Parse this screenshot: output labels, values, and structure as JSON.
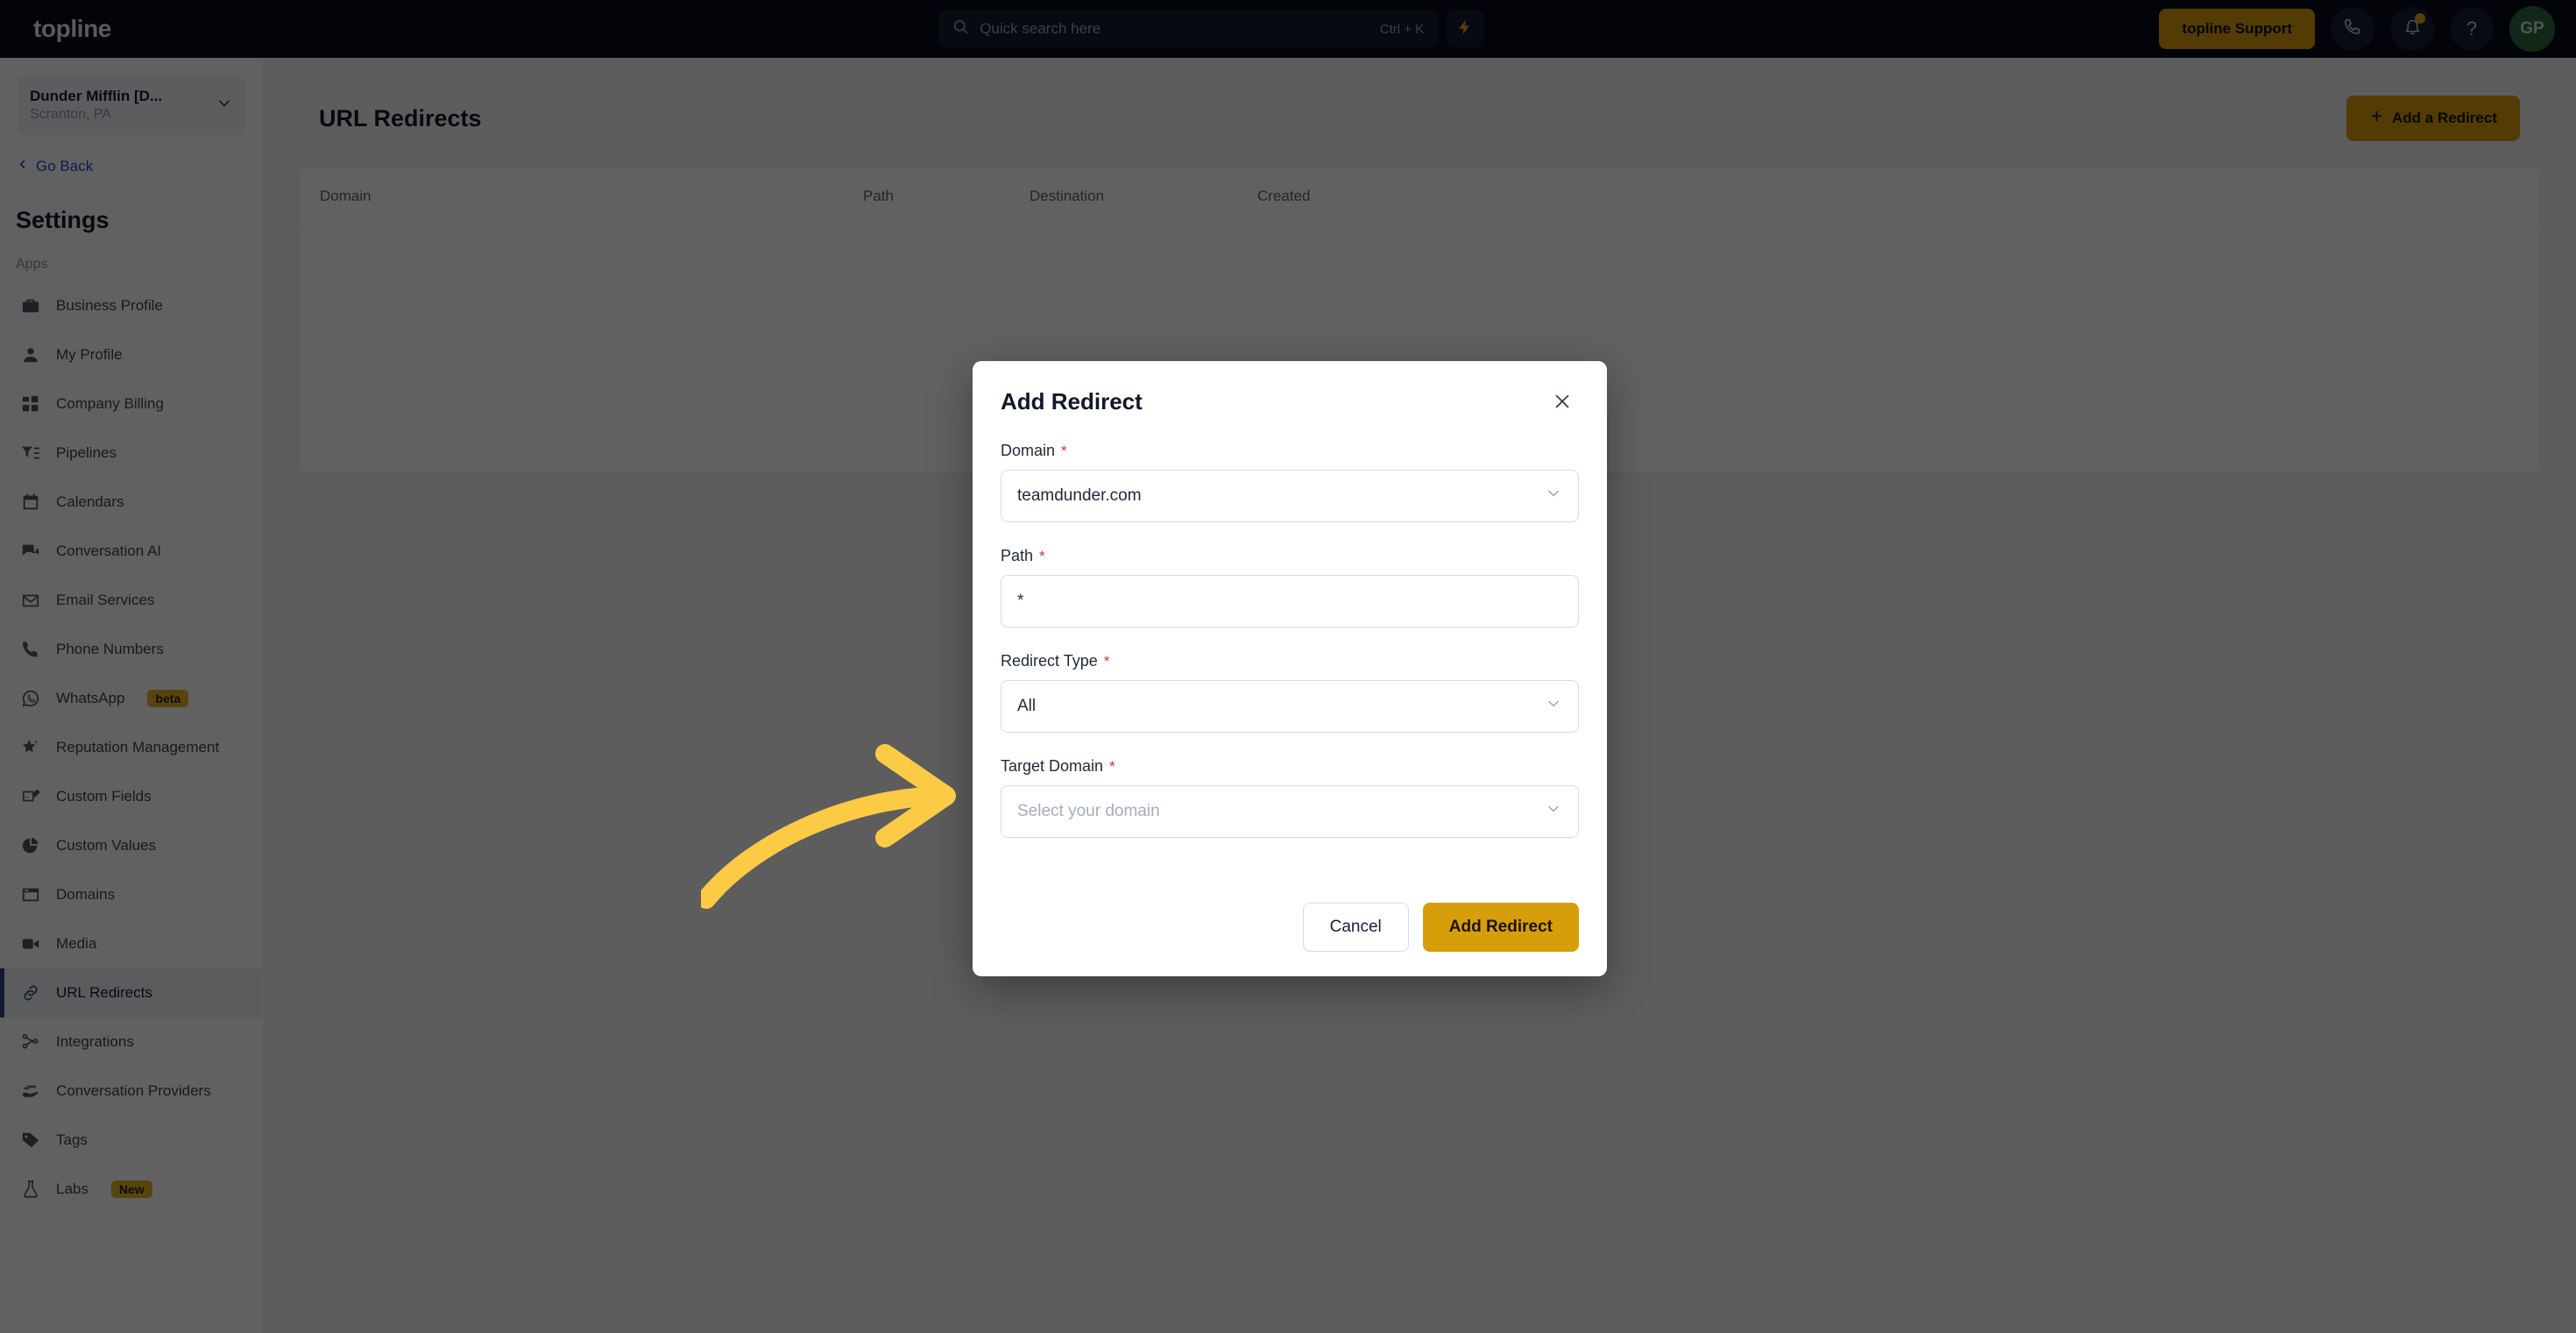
{
  "topbar": {
    "brand": "topline",
    "search": {
      "placeholder": "Quick search here",
      "shortcut": "Ctrl + K",
      "icon": "search-icon"
    },
    "bolt_icon": "lightning-bolt-icon",
    "support_label": "topline Support",
    "phone_icon": "phone-icon",
    "bell_icon": "bell-icon",
    "help_icon": "question-mark-icon",
    "avatar_initials": "GP",
    "accent_color": "#d79e0b",
    "background_color": "#070d1c"
  },
  "sidebar": {
    "location_name": "Dunder Mifflin [D...",
    "location_sub": "Scranton, PA",
    "location_chevron_icon": "chevron-down-icon",
    "go_back": "Go Back",
    "go_back_icon": "chevron-left-icon",
    "section_title": "Settings",
    "group_label": "Apps",
    "active_item": "URL Redirects",
    "items": [
      {
        "label": "Business Profile",
        "icon": "briefcase-icon",
        "badge": null
      },
      {
        "label": "My Profile",
        "icon": "person-icon",
        "badge": null
      },
      {
        "label": "Company Billing",
        "icon": "billing-grid-icon",
        "badge": null
      },
      {
        "label": "Pipelines",
        "icon": "funnel-icon",
        "badge": null
      },
      {
        "label": "Calendars",
        "icon": "calendar-icon",
        "badge": null
      },
      {
        "label": "Conversation AI",
        "icon": "chat-bubbles-icon",
        "badge": null
      },
      {
        "label": "Email Services",
        "icon": "envelope-icon",
        "badge": null
      },
      {
        "label": "Phone Numbers",
        "icon": "phone-icon",
        "badge": null
      },
      {
        "label": "WhatsApp",
        "icon": "whatsapp-icon",
        "badge": "beta"
      },
      {
        "label": "Reputation Management",
        "icon": "star-icon",
        "badge": null
      },
      {
        "label": "Custom Fields",
        "icon": "pencil-card-icon",
        "badge": null
      },
      {
        "label": "Custom Values",
        "icon": "pie-chart-icon",
        "badge": null
      },
      {
        "label": "Domains",
        "icon": "browser-window-icon",
        "badge": null
      },
      {
        "label": "Media",
        "icon": "video-camera-icon",
        "badge": null
      },
      {
        "label": "URL Redirects",
        "icon": "link-chain-icon",
        "badge": null
      },
      {
        "label": "Integrations",
        "icon": "nodes-icon",
        "badge": null
      },
      {
        "label": "Conversation Providers",
        "icon": "hand-message-icon",
        "badge": null
      },
      {
        "label": "Tags",
        "icon": "tag-icon",
        "badge": null
      },
      {
        "label": "Labs",
        "icon": "flask-icon",
        "badge": "New"
      }
    ]
  },
  "main": {
    "page_title": "URL Redirects",
    "add_button": "Add a Redirect",
    "add_button_icon": "plus-icon",
    "table": {
      "columns": [
        "Domain",
        "Path",
        "Destination",
        "Created"
      ],
      "rows": []
    }
  },
  "modal": {
    "title": "Add Redirect",
    "close_icon": "close-x-icon",
    "fields": [
      {
        "label": "Domain",
        "required": true,
        "value": "teamdunder.com",
        "placeholder": "",
        "control": "select",
        "icon": "chevron-down-icon"
      },
      {
        "label": "Path",
        "required": true,
        "value": "*",
        "placeholder": "",
        "control": "text",
        "icon": ""
      },
      {
        "label": "Redirect Type",
        "required": true,
        "value": "All",
        "placeholder": "",
        "control": "select",
        "icon": "chevron-down-icon"
      },
      {
        "label": "Target Domain",
        "required": true,
        "value": "",
        "placeholder": "Select your domain",
        "control": "select",
        "icon": "chevron-down-icon"
      }
    ],
    "cancel_label": "Cancel",
    "submit_label": "Add Redirect"
  },
  "annotations": {
    "highlight_color": "#ffd14d",
    "arrow_color": "#fbcb45",
    "arrow_direction": "right",
    "highlight_target": "Redirect Type and Target Domain fields"
  }
}
